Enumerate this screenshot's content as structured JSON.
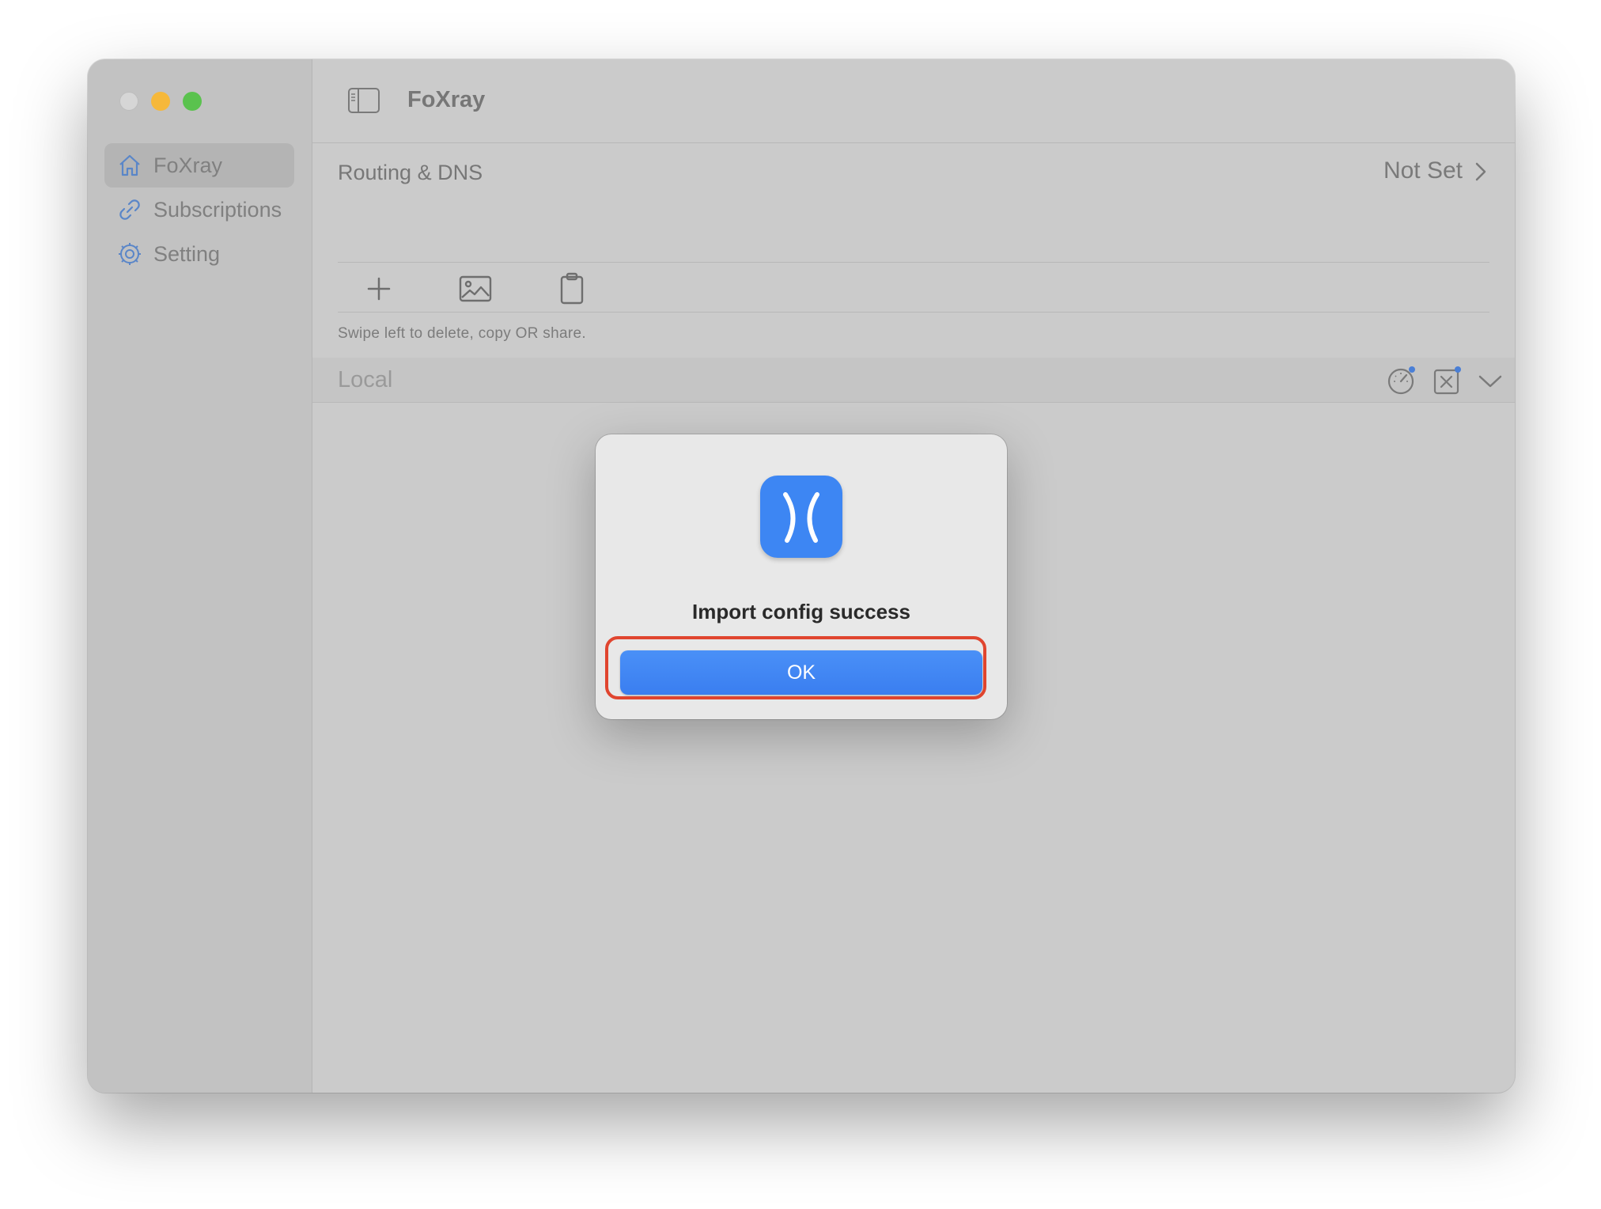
{
  "window": {
    "title": "FoXray"
  },
  "sidebar": {
    "items": [
      {
        "label": "FoXray",
        "icon": "house-icon",
        "active": true
      },
      {
        "label": "Subscriptions",
        "icon": "link-icon",
        "active": false
      },
      {
        "label": "Setting",
        "icon": "gear-icon",
        "active": false
      }
    ]
  },
  "routing": {
    "label": "Routing & DNS",
    "value": "Not Set"
  },
  "toolbar": {
    "icons": [
      "plus-icon",
      "image-icon",
      "clipboard-icon"
    ]
  },
  "hint": "Swipe left to delete, copy OR share.",
  "section": {
    "label": "Local",
    "icons": [
      "speedometer-icon",
      "clear-icon",
      "chevron-down-icon"
    ]
  },
  "dialog": {
    "message": "Import config success",
    "ok_label": "OK",
    "icon": "app-icon"
  },
  "colors": {
    "accent": "#3d86f3",
    "highlight": "#e0452f"
  }
}
